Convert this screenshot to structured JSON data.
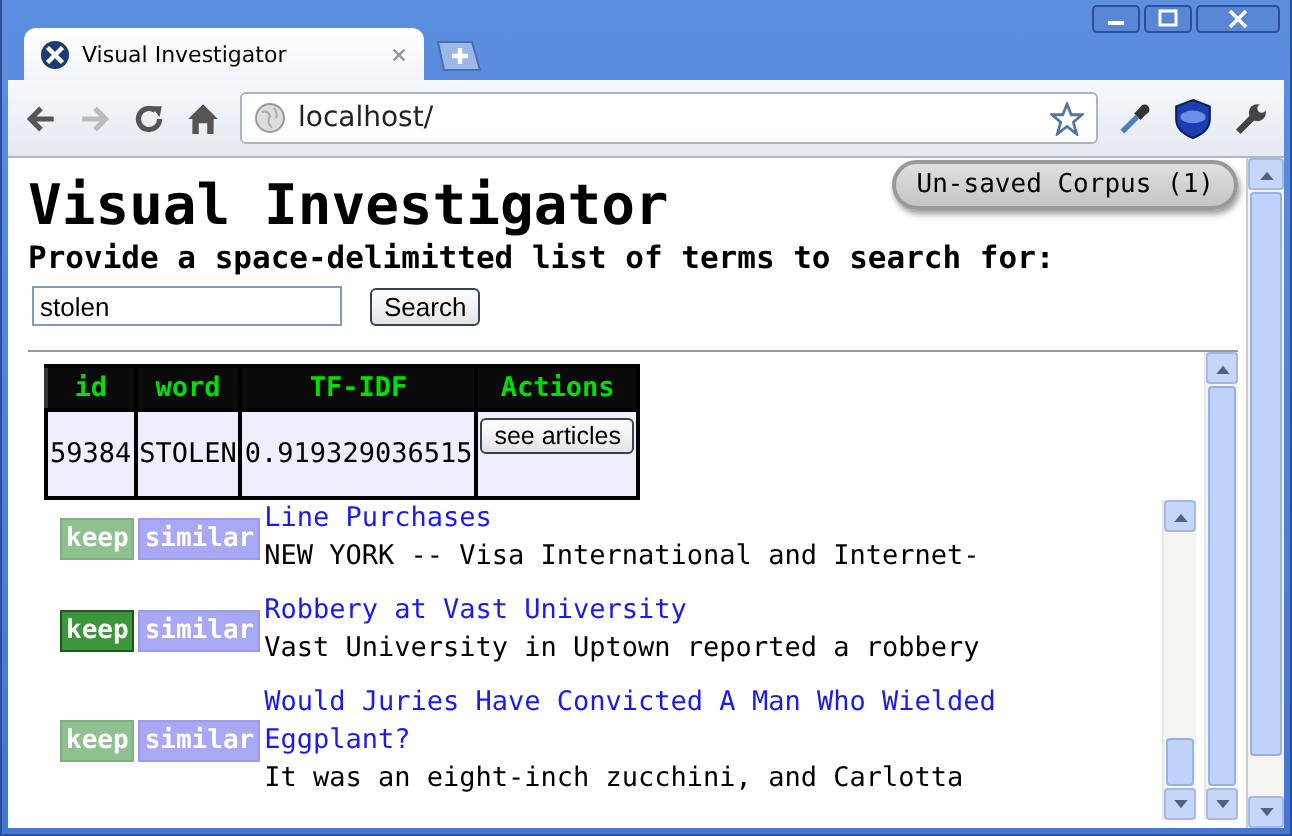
{
  "tabs": [
    {
      "title": "Visual Investigator",
      "selected": true
    }
  ],
  "address": "localhost/",
  "page": {
    "heading": "Visual Investigator",
    "corpus_badge": "Un-saved Corpus (1)",
    "prompt": "Provide a space-delimitted list of terms to search for:",
    "search_value": "stolen",
    "search_button": "Search"
  },
  "table": {
    "columns": [
      "id",
      "word",
      "TF-IDF",
      "Actions"
    ],
    "rows": [
      {
        "id": "59384",
        "word": "STOLEN",
        "tf_idf": "0.919329036515",
        "action": "see articles"
      }
    ]
  },
  "articles": [
    {
      "keep": "keep",
      "kept": false,
      "similar": "similar",
      "title": "Line Purchases",
      "snippet": "NEW YORK -- Visa International and Internet-"
    },
    {
      "keep": "keep",
      "kept": true,
      "similar": "similar",
      "title": "Robbery at Vast University",
      "snippet": "Vast University in Uptown reported a robbery"
    },
    {
      "keep": "keep",
      "kept": false,
      "similar": "similar",
      "title": "Would Juries Have Convicted A Man Who Wielded Eggplant?",
      "snippet": "It was an eight-inch zucchini, and Carlotta"
    }
  ]
}
